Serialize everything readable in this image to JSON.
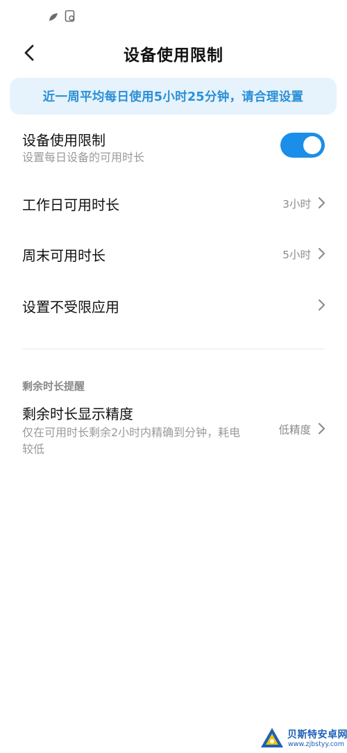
{
  "header": {
    "title": "设备使用限制",
    "back_icon": "chevron-left-icon"
  },
  "banner": {
    "text": "近一周平均每日使用5小时25分钟，请合理设置",
    "color": "#2a8fd6",
    "background": "#e6f3fc"
  },
  "device_limit": {
    "title": "设备使用限制",
    "subtitle": "设置每日设备的可用时长",
    "toggle_on": true,
    "accent": "#1a8ee8"
  },
  "weekday": {
    "title": "工作日可用时长",
    "value": "3小时"
  },
  "weekend": {
    "title": "周末可用时长",
    "value": "5小时"
  },
  "unrestricted_apps": {
    "title": "设置不受限应用"
  },
  "reminder_section": {
    "header": "剩余时长提醒",
    "precision": {
      "title": "剩余时长显示精度",
      "desc_line1": "仅在可用时长剩余2小时内精确到分钟，耗电",
      "desc_line2": "较低",
      "value": "低精度"
    }
  },
  "watermark": {
    "name": "贝斯特安卓网",
    "url": "www.zjbstyy.com"
  }
}
